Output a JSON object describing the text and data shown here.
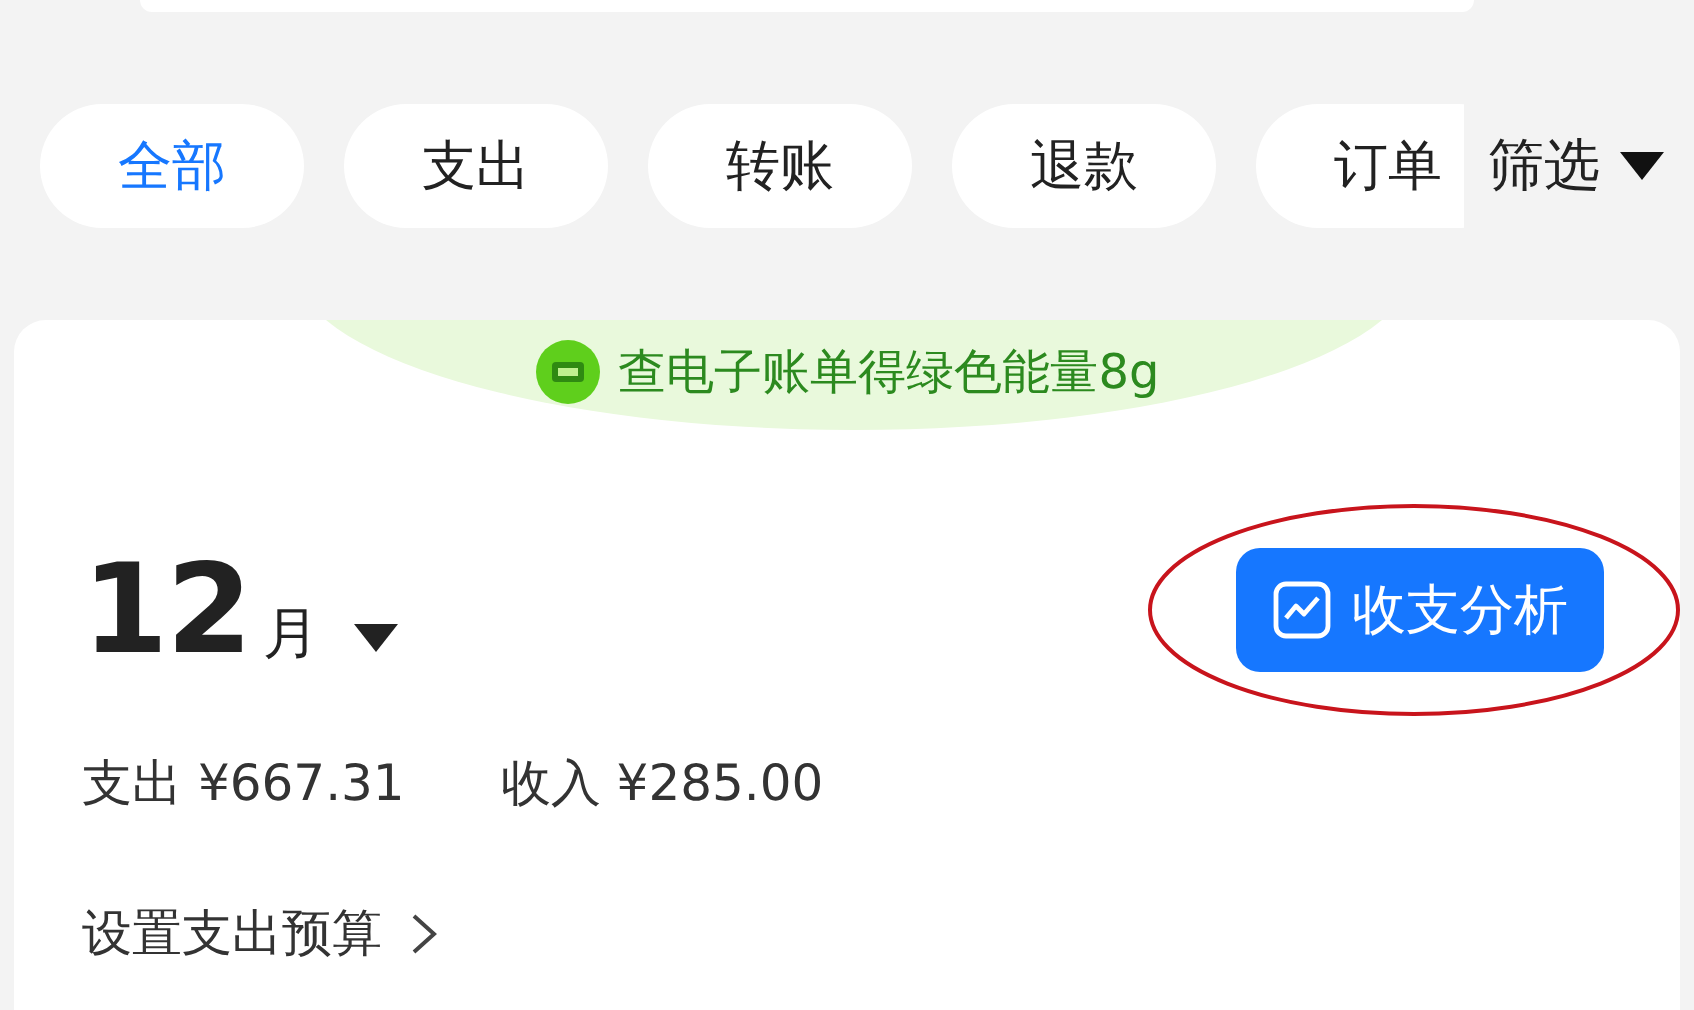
{
  "tabs": [
    {
      "label": "全部",
      "selected": true
    },
    {
      "label": "支出",
      "selected": false
    },
    {
      "label": "转账",
      "selected": false
    },
    {
      "label": "退款",
      "selected": false
    },
    {
      "label": "订单",
      "selected": false
    }
  ],
  "filter": {
    "label": "筛选"
  },
  "banner": {
    "text": "查电子账单得绿色能量8g"
  },
  "month": {
    "number": "12",
    "unit": "月"
  },
  "analysis_button": {
    "label": "收支分析"
  },
  "summary": [
    {
      "label": "支出",
      "amount": "¥667.31"
    },
    {
      "label": "收入",
      "amount": "¥285.00"
    }
  ],
  "budget_link": {
    "label": "设置支出预算"
  }
}
